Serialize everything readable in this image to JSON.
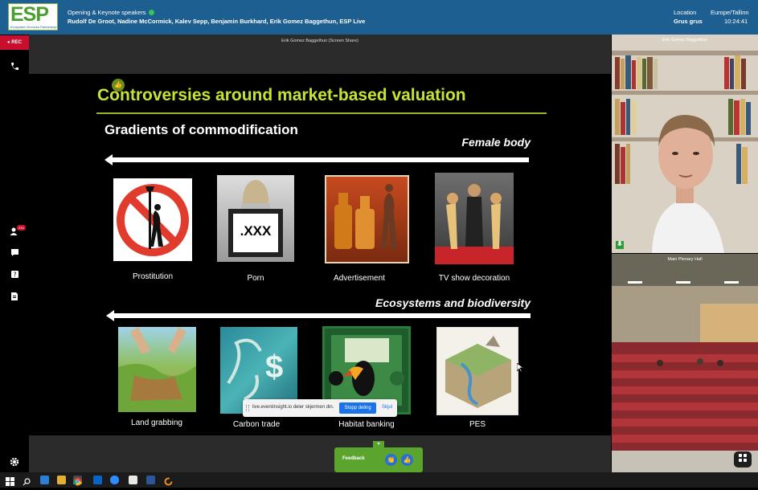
{
  "header": {
    "logo_text": "ESP",
    "logo_subtext": "Ecosystem Services Partnership",
    "session_title": "Opening & Keynote speakers",
    "speakers": "Rudolf De Groot, Nadine McCormick, Kalev Sepp, Benjamin Burkhard, Erik Gomez Baggethun, ESP Live",
    "location_label": "Location",
    "location_value": "Grus grus",
    "timezone_label": "Europe/Tallinn",
    "time_value": "10:24:41"
  },
  "sidebar": {
    "rec_label": "● REC",
    "badge": "234"
  },
  "stage": {
    "label": "Erik Gomez Baggethun (Screen Share)"
  },
  "slide": {
    "title": "Controversies around market-based valuation",
    "subtitle": "Gradients of commodification",
    "section1": "Female body",
    "section2": "Ecosystems and biodiversity",
    "row1_captions": [
      "Prostitution",
      "Porn",
      "Advertisement",
      "TV show decoration"
    ],
    "row2_captions": [
      "Land grabbing",
      "Carbon trade",
      "Habitat banking",
      "PES"
    ],
    "porn_text": ".XXX",
    "money_symbol": "$"
  },
  "share_bar": {
    "text": "live.eventinsight.io deler skjermen din.",
    "stop_label": "Stopp deling",
    "hide_label": "Skjul"
  },
  "cameras": {
    "cam1_label": "Erik Gomez Baggethun",
    "cam2_label": "Main Plenary Hall"
  },
  "feedback": {
    "label": "Feedback"
  },
  "colors": {
    "header_bg": "#1d5f91",
    "accent_green": "#5ba52f",
    "title_green": "#c8e234",
    "rec_red": "#c8102e"
  }
}
